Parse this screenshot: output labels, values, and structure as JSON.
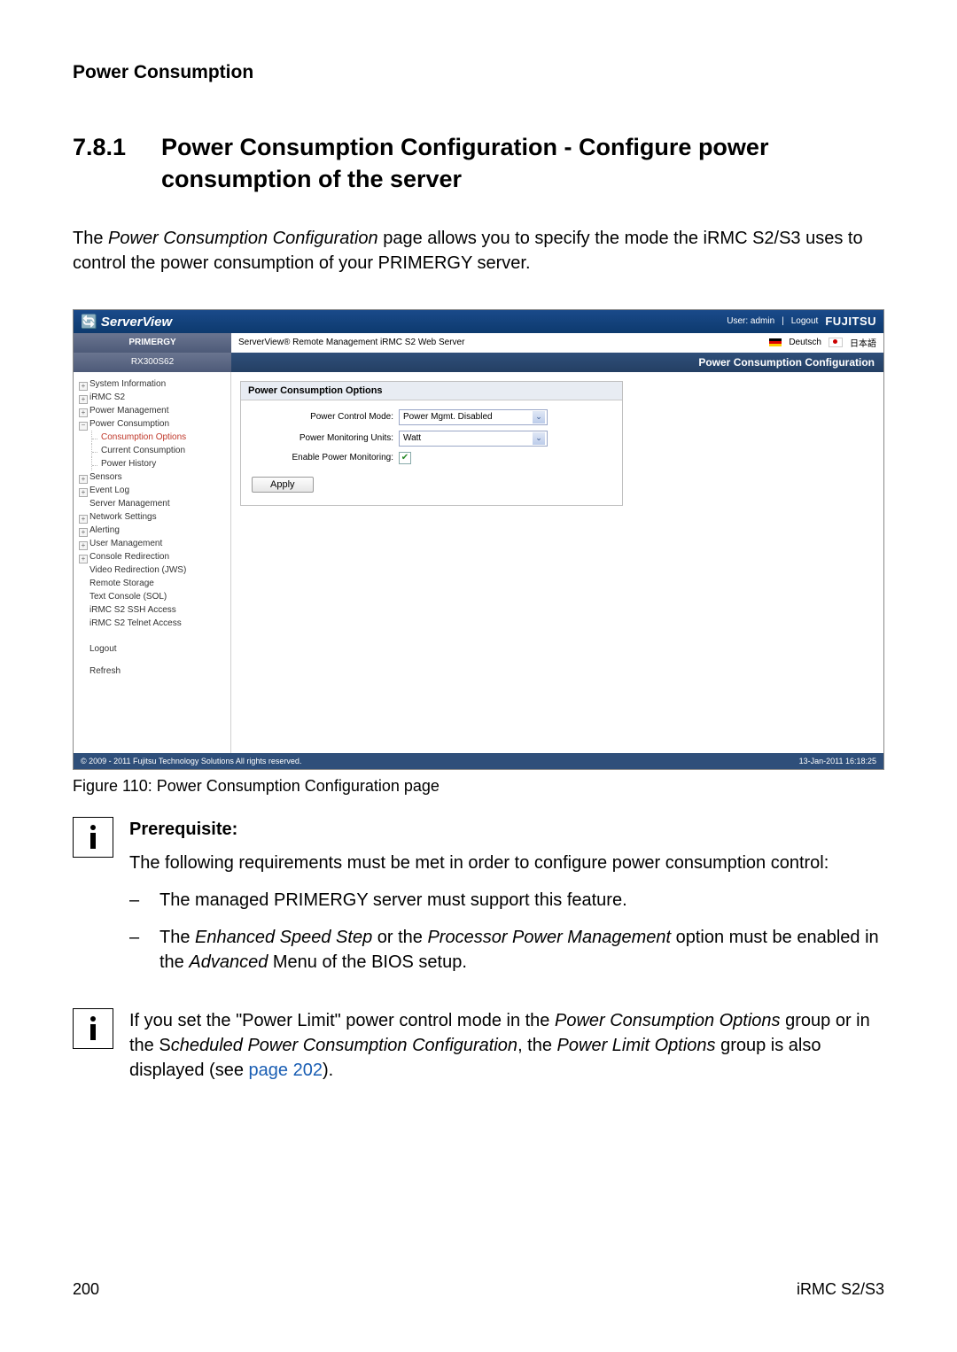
{
  "running_head": "Power Consumption",
  "section_number": "7.8.1",
  "section_title": "Power Consumption Configuration - Configure power consumption of the server",
  "intro_a": "The ",
  "intro_i": "Power Consumption Configuration",
  "intro_b": " page allows you to specify the mode the iRMC S2/S3 uses to control the power consumption of your PRIMERGY server.",
  "figure_caption": "Figure 110: Power Consumption Configuration page",
  "prereq_heading": "Prerequisite:",
  "prereq_intro": "The following requirements must be met in order to configure power consumption control:",
  "prereq_items": [
    {
      "text": "The managed PRIMERGY server must support this feature."
    },
    {
      "a": "The ",
      "i1": "Enhanced Speed Step",
      "mid": " or the ",
      "i2": "Processor Power Management",
      "tail": " option must be enabled in the ",
      "i3": "Advanced",
      "tail2": " Menu of the BIOS setup."
    }
  ],
  "note2": {
    "a": "If you set the \"Power Limit\" power control mode in the ",
    "i1": "Power Consumption Options",
    "b": " group or in the S",
    "i2": "cheduled Power Consumption Configuration",
    "c": ", the ",
    "i3": "Power Limit Options",
    "d": " group is also displayed (see ",
    "link": "page 202",
    "e": ")."
  },
  "footer_left": "200",
  "footer_right": "iRMC S2/S3",
  "screenshot": {
    "brand": "ServerView",
    "user_label": "User: admin",
    "logout": "Logout",
    "vendor": "FUJITSU",
    "row2_left": "PRIMERGY",
    "row2_center": "ServerView® Remote Management iRMC S2 Web Server",
    "lang_de": "Deutsch",
    "lang_jp": "日本語",
    "row3_left": "RX300S62",
    "row3_right": "Power Consumption Configuration",
    "nav": {
      "items": [
        {
          "label": "System Information",
          "type": "expandable"
        },
        {
          "label": "iRMC S2",
          "type": "expandable"
        },
        {
          "label": "Power Management",
          "type": "expandable"
        },
        {
          "label": "Power Consumption",
          "type": "expanded",
          "children": [
            {
              "label": "Consumption Options",
              "active": true
            },
            {
              "label": "Current Consumption"
            },
            {
              "label": "Power History"
            }
          ]
        },
        {
          "label": "Sensors",
          "type": "expandable"
        },
        {
          "label": "Event Log",
          "type": "expandable"
        },
        {
          "label": "Server Management",
          "type": "leaf"
        },
        {
          "label": "Network Settings",
          "type": "expandable"
        },
        {
          "label": "Alerting",
          "type": "expandable"
        },
        {
          "label": "User Management",
          "type": "expandable"
        },
        {
          "label": "Console Redirection",
          "type": "expandable"
        },
        {
          "label": "Video Redirection (JWS)",
          "type": "leaf"
        },
        {
          "label": "Remote Storage",
          "type": "leaf"
        },
        {
          "label": "Text Console (SOL)",
          "type": "leaf"
        },
        {
          "label": "iRMC S2 SSH Access",
          "type": "leaf"
        },
        {
          "label": "iRMC S2 Telnet Access",
          "type": "leaf"
        }
      ],
      "logout": "Logout",
      "refresh": "Refresh"
    },
    "panel": {
      "title": "Power Consumption Options",
      "rows": [
        {
          "label": "Power Control Mode:",
          "value": "Power Mgmt. Disabled",
          "kind": "select"
        },
        {
          "label": "Power Monitoring Units:",
          "value": "Watt",
          "kind": "select"
        },
        {
          "label": "Enable Power Monitoring:",
          "value": "checked",
          "kind": "checkbox"
        }
      ],
      "apply": "Apply"
    },
    "footer_left": "© 2009 - 2011 Fujitsu Technology Solutions All rights reserved.",
    "footer_right": "13-Jan-2011 16:18:25"
  }
}
